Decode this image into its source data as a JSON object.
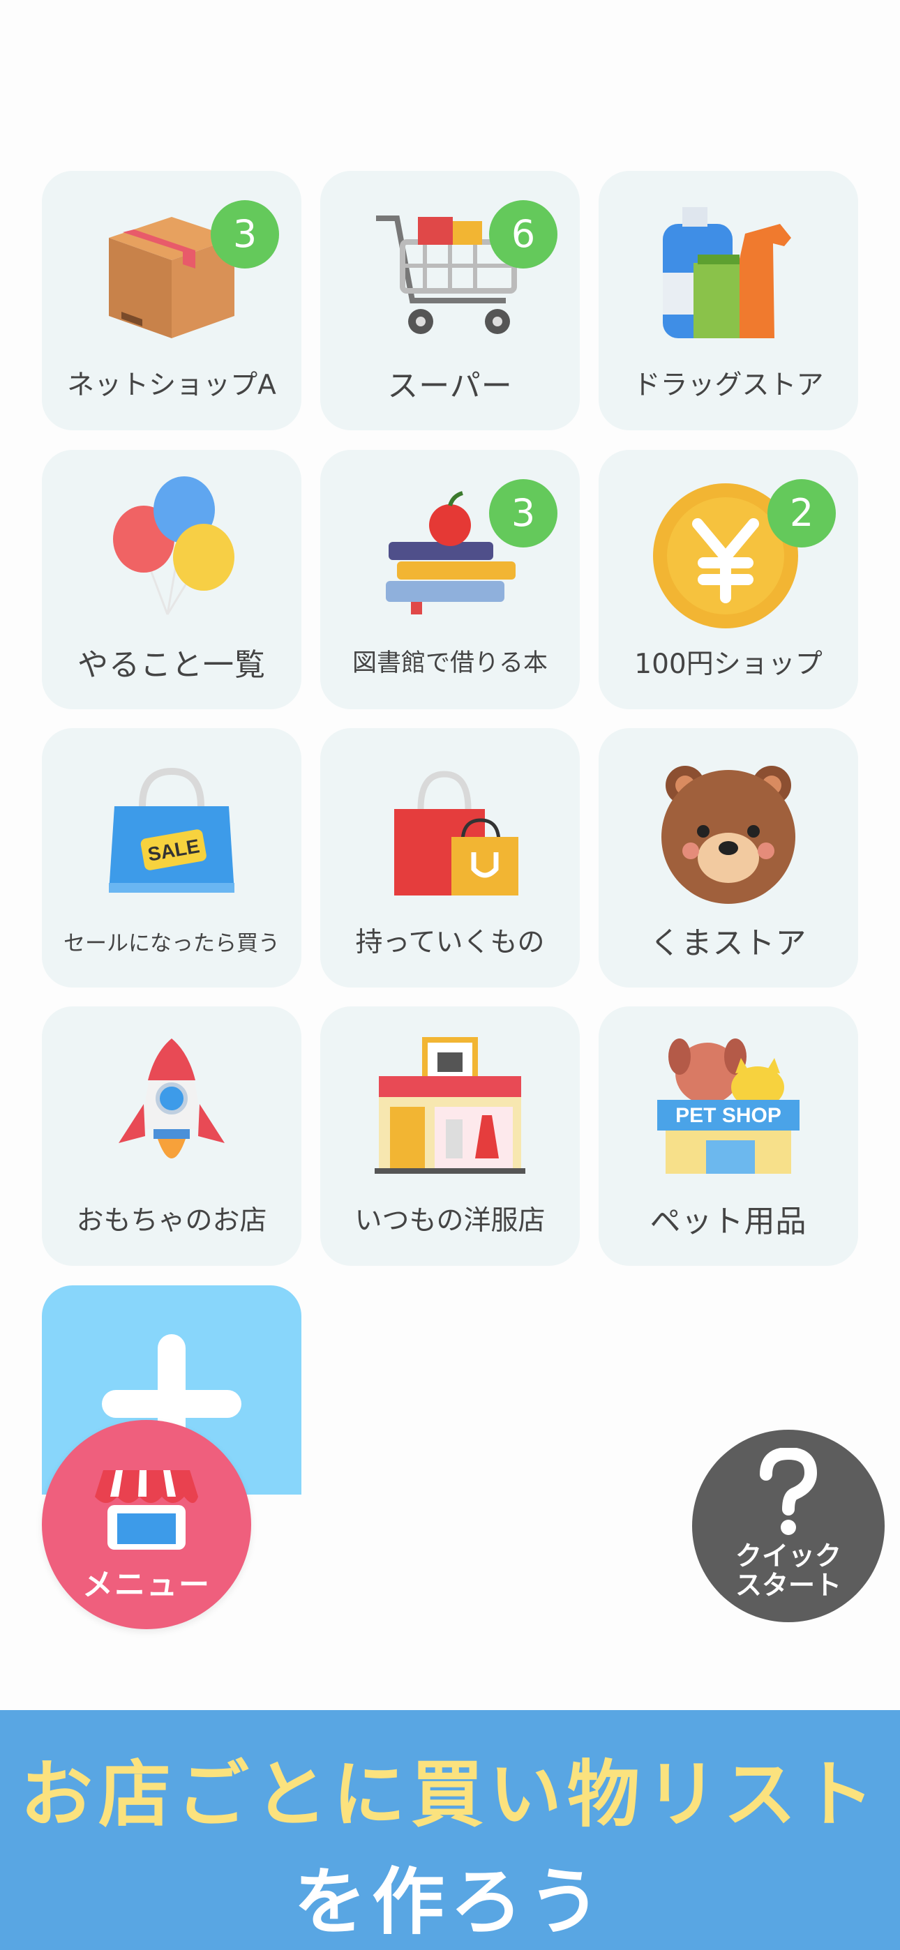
{
  "tiles": [
    {
      "label": "ネットショップA",
      "badge": "3",
      "icon": "cardboard-box-icon"
    },
    {
      "label": "スーパー",
      "badge": "6",
      "icon": "shopping-cart-icon"
    },
    {
      "label": "ドラッグストア",
      "badge": "",
      "icon": "cleaning-bottles-icon"
    },
    {
      "label": "やること一覧",
      "badge": "",
      "icon": "balloons-icon"
    },
    {
      "label": "図書館で借りる本",
      "badge": "3",
      "icon": "books-apple-icon"
    },
    {
      "label": "100円ショップ",
      "badge": "2",
      "icon": "yen-coin-icon"
    },
    {
      "label": "セールになったら買う",
      "badge": "",
      "icon": "sale-bag-icon"
    },
    {
      "label": "持っていくもの",
      "badge": "",
      "icon": "shopping-bags-icon"
    },
    {
      "label": "くまストア",
      "badge": "",
      "icon": "bear-face-icon"
    },
    {
      "label": "おもちゃのお店",
      "badge": "",
      "icon": "rocket-icon"
    },
    {
      "label": "いつもの洋服店",
      "badge": "",
      "icon": "clothing-store-icon"
    },
    {
      "label": "ペット用品",
      "badge": "",
      "icon": "pet-shop-icon",
      "sign": "PET SHOP"
    }
  ],
  "sale_tag": "SALE",
  "menu_button": {
    "label": "メニュー"
  },
  "quick_start": {
    "label_line1": "クイック",
    "label_line2": "スタート"
  },
  "banner": {
    "line1": "お店ごとに買い物リスト",
    "line2": "を作ろう"
  },
  "colors": {
    "tile_bg": "#eef5f6",
    "badge": "#64c95b",
    "menu": "#ef5f7d",
    "quick_start": "#5d5d5d",
    "banner": "#59a6e3",
    "banner_text_highlight": "#fbe27e",
    "add_tile": "#88d6fb"
  }
}
